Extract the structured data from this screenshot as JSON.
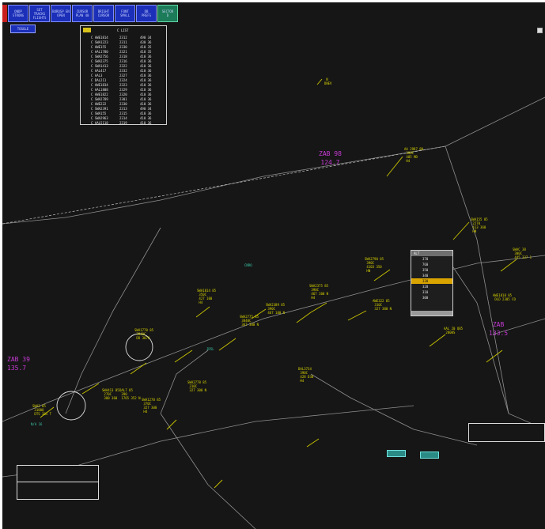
{
  "toolbar": {
    "buttons": [
      "ONDP",
      "SET TRACKS",
      "BOROSP EN",
      "CURSOR",
      "BRIGHT",
      "FONT",
      "DB",
      "SECTOR"
    ],
    "secondary": [
      "STRONG",
      "FLIGHTS",
      "OPEN",
      "PLAN 40",
      "CURSOR",
      "SMALL",
      "PREFS",
      "D"
    ]
  },
  "toggle_label": "TOGGLE",
  "list": {
    "title": "C LIST",
    "rows": [
      [
        "C AWE1814",
        "2312",
        "490 34"
      ],
      [
        "C SWA1223",
        "2311",
        "430 36"
      ],
      [
        "C AWE155",
        "2330",
        "410 35"
      ],
      [
        "C AAL1780",
        "2321",
        "410 35"
      ],
      [
        "C SWA2756",
        "2318",
        "410 36"
      ],
      [
        "C SWA2375",
        "2316",
        "410 36"
      ],
      [
        "C SWA1413",
        "2322",
        "410 36"
      ],
      [
        "C AAL417",
        "2332",
        "410 36"
      ],
      [
        "C AAL3",
        "2327",
        "410 36"
      ],
      [
        "C DAL211",
        "2324",
        "410 36"
      ],
      [
        "C AWE1834",
        "2323",
        "410 36"
      ],
      [
        "C AAL1808",
        "2329",
        "410 36"
      ],
      [
        "C AWE1822",
        "2320",
        "410 36"
      ],
      [
        "C SWA2789",
        "2301",
        "410 36"
      ],
      [
        "C AWE222",
        "2330",
        "410 36"
      ],
      [
        "C SWA2391",
        "2313",
        "490 34"
      ],
      [
        "C SWA155",
        "2315",
        "410 36"
      ],
      [
        "C SWA2963",
        "2314",
        "410 36"
      ],
      [
        "C AAL5118",
        "2319",
        "410 36"
      ]
    ]
  },
  "sectors": [
    {
      "name": "ZAB 98",
      "freq": "124.7"
    },
    {
      "name": "ZAB 39",
      "freq": "135.7"
    },
    {
      "name": "ZAB",
      "freq": "133.5"
    }
  ],
  "aircraft": [
    {
      "label": "   N\n  DNEV"
    },
    {
      "label": "AA 2987 80\n 390C\n 405 MD\n H4"
    },
    {
      "label": "SWA155 85\n 2270\n 413 360\n HN"
    },
    {
      "label": "SWA180 85\n 390C\n 467 100 N"
    },
    {
      "label": "SWA2790 85\n 390C\n 4103 350\n HN"
    },
    {
      "label": "SWA2375 85\n 390C\n 467 100 N\n H4"
    },
    {
      "label": "AWE322 85\n 310C\n 327 380 N"
    },
    {
      "label": "SWA2389 85\n 390C\n 467 100 N"
    },
    {
      "label": "SWA1814 85\n 350C\n 427 100\n H4"
    },
    {
      "label": "SWA1770 85\n 3940C\n DD 3070"
    },
    {
      "label": "SWA2775 85\n 3840C\n 367 300 N"
    },
    {
      "label": "SWA413 85\n 270C\n 300 360"
    },
    {
      "label": "DAL3734\n 390C\n 428 D30\n H4"
    },
    {
      "label": "SWA2778 85\n 310C\n 327 300 N"
    },
    {
      "label": "SWA1270 85\n 370C\n 327 300\n H4"
    },
    {
      "label": "SWAC 38\n 300C\n 445 337 1"
    },
    {
      "label": "AAL 20 Q85\n 2000S"
    },
    {
      "label": "AWE1818 85\n DLD 2305 CO"
    },
    {
      "label": "SWA2 05\n 3100Q\n DTS 305 T"
    },
    {
      "label": "DAL7 85\n 390\n 1765 352 N"
    }
  ],
  "misc_labels": [
    "CNRO",
    "JR5L",
    "N/A 16"
  ],
  "popup": {
    "header": "ALT",
    "items": [
      "370",
      "760",
      "350",
      "340",
      "330",
      "320",
      "310",
      "300"
    ],
    "selected_index": 4
  }
}
